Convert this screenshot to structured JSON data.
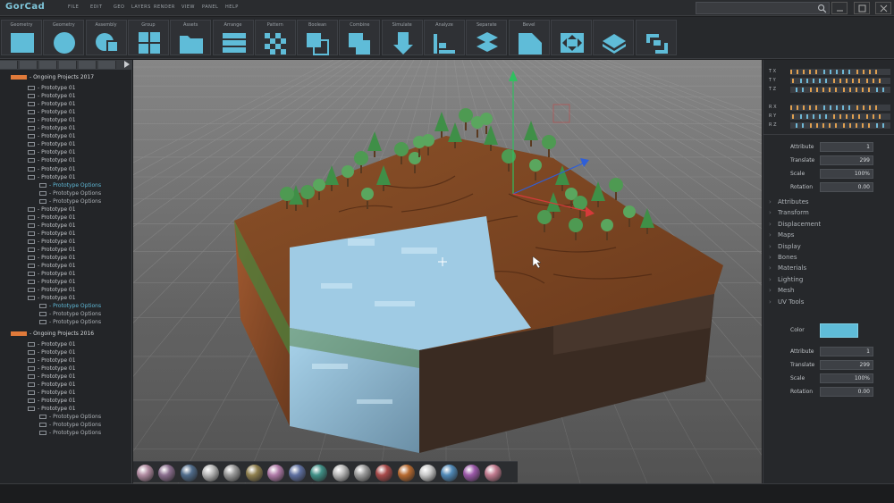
{
  "app": {
    "title": "GorCAD",
    "logo_text": "GorCad"
  },
  "menu": [
    "FILE",
    "EDIT",
    "GEO",
    "LAYERS",
    "RENDER",
    "VIEW",
    "PANEL",
    "HELP"
  ],
  "toolbar": {
    "tools": [
      {
        "label": "Geometry",
        "icon": "cube-icon"
      },
      {
        "label": "Geometry",
        "icon": "sphere-icon"
      },
      {
        "label": "Assembly",
        "icon": "assembly-icon"
      },
      {
        "label": "Group",
        "icon": "group-icon"
      },
      {
        "label": "Assets",
        "icon": "folder-icon"
      },
      {
        "label": "Arrange",
        "icon": "arrange-icon"
      },
      {
        "label": "Pattern",
        "icon": "pattern-icon"
      },
      {
        "label": "Boolean",
        "icon": "boolean-icon"
      },
      {
        "label": "Combine",
        "icon": "combine-icon"
      },
      {
        "label": "Simulate",
        "icon": "simulate-icon"
      },
      {
        "label": "Analyze",
        "icon": "analyze-icon"
      },
      {
        "label": "Separate",
        "icon": "separate-icon"
      },
      {
        "label": "Bevel",
        "icon": "bevel-icon"
      },
      {
        "label": "",
        "icon": "snap-icon"
      },
      {
        "label": "",
        "icon": "layers-icon"
      },
      {
        "label": "",
        "icon": "connect-icon"
      }
    ]
  },
  "tree": {
    "groups": [
      {
        "title": "- Ongoing Projects 2017",
        "rows": [
          {
            "text": "- Prototype 01",
            "kind": "item"
          },
          {
            "text": "- Prototype 01",
            "kind": "item"
          },
          {
            "text": "- Prototype 01",
            "kind": "item"
          },
          {
            "text": "- Prototype 01",
            "kind": "item"
          },
          {
            "text": "- Prototype 01",
            "kind": "item"
          },
          {
            "text": "- Prototype 01",
            "kind": "item"
          },
          {
            "text": "- Prototype 01",
            "kind": "item"
          },
          {
            "text": "- Prototype 01",
            "kind": "item"
          },
          {
            "text": "- Prototype 01",
            "kind": "item"
          },
          {
            "text": "- Prototype 01",
            "kind": "item"
          },
          {
            "text": "- Prototype 01",
            "kind": "item"
          },
          {
            "text": "- Prototype 01",
            "kind": "item"
          },
          {
            "text": "- Prototype Options",
            "kind": "sel"
          },
          {
            "text": "- Prototype Options",
            "kind": "opt"
          },
          {
            "text": "- Prototype Options",
            "kind": "opt"
          },
          {
            "text": "- Prototype 01",
            "kind": "item"
          },
          {
            "text": "- Prototype 01",
            "kind": "item"
          },
          {
            "text": "- Prototype 01",
            "kind": "item"
          },
          {
            "text": "- Prototype 01",
            "kind": "item"
          },
          {
            "text": "- Prototype 01",
            "kind": "item"
          },
          {
            "text": "- Prototype 01",
            "kind": "item"
          },
          {
            "text": "- Prototype 01",
            "kind": "item"
          },
          {
            "text": "- Prototype 01",
            "kind": "item"
          },
          {
            "text": "- Prototype 01",
            "kind": "item"
          },
          {
            "text": "- Prototype 01",
            "kind": "item"
          },
          {
            "text": "- Prototype 01",
            "kind": "item"
          },
          {
            "text": "- Prototype 01",
            "kind": "item"
          },
          {
            "text": "- Prototype Options",
            "kind": "sel"
          },
          {
            "text": "- Prototype Options",
            "kind": "opt"
          },
          {
            "text": "- Prototype Options",
            "kind": "opt"
          }
        ]
      },
      {
        "title": "- Ongoing Projects 2016",
        "rows": [
          {
            "text": "- Prototype 01",
            "kind": "item"
          },
          {
            "text": "- Prototype 01",
            "kind": "item"
          },
          {
            "text": "- Prototype 01",
            "kind": "item"
          },
          {
            "text": "- Prototype 01",
            "kind": "item"
          },
          {
            "text": "- Prototype 01",
            "kind": "item"
          },
          {
            "text": "- Prototype 01",
            "kind": "item"
          },
          {
            "text": "- Prototype 01",
            "kind": "item"
          },
          {
            "text": "- Prototype 01",
            "kind": "item"
          },
          {
            "text": "- Prototype 01",
            "kind": "item"
          },
          {
            "text": "- Prototype Options",
            "kind": "opt"
          },
          {
            "text": "- Prototype Options",
            "kind": "opt"
          },
          {
            "text": "- Prototype Options",
            "kind": "opt"
          }
        ]
      }
    ]
  },
  "graph": {
    "top": [
      "T  X",
      "T  Y",
      "T  Z"
    ],
    "bottom": [
      "R  X",
      "R  Y",
      "R  Z"
    ]
  },
  "transform_top": [
    {
      "label": "Attribute",
      "value": "1"
    },
    {
      "label": "Translate",
      "value": "299"
    },
    {
      "label": "Scale",
      "value": "100%"
    },
    {
      "label": "Rotation",
      "value": "0.00"
    }
  ],
  "accordion": [
    "Attributes",
    "Transform",
    "Displacement",
    "Maps",
    "Display",
    "Bones",
    "Materials",
    "Lighting",
    "Mesh",
    "UV Tools"
  ],
  "color_label": "Color",
  "transform_bottom": [
    {
      "label": "Attribute",
      "value": "1"
    },
    {
      "label": "Translate",
      "value": "299"
    },
    {
      "label": "Scale",
      "value": "100%"
    },
    {
      "label": "Rotation",
      "value": "0.00"
    }
  ],
  "colors": {
    "accent": "#5fbcd8",
    "project_marker": "#e07a3a",
    "selected_item": "#5fb8d6"
  },
  "materials": [
    "#b08aa0",
    "#8a6e8e",
    "#4f6b8a",
    "#b7b7b7",
    "#9a9a9a",
    "#8f7f4e",
    "#b07aa8",
    "#5e6fa0",
    "#3f8f86",
    "#b9b9b9",
    "#9d9d9d",
    "#a84a4a",
    "#b86a30",
    "#c9c9c9",
    "#4f88b6",
    "#9a58a8",
    "#c07a8e"
  ]
}
